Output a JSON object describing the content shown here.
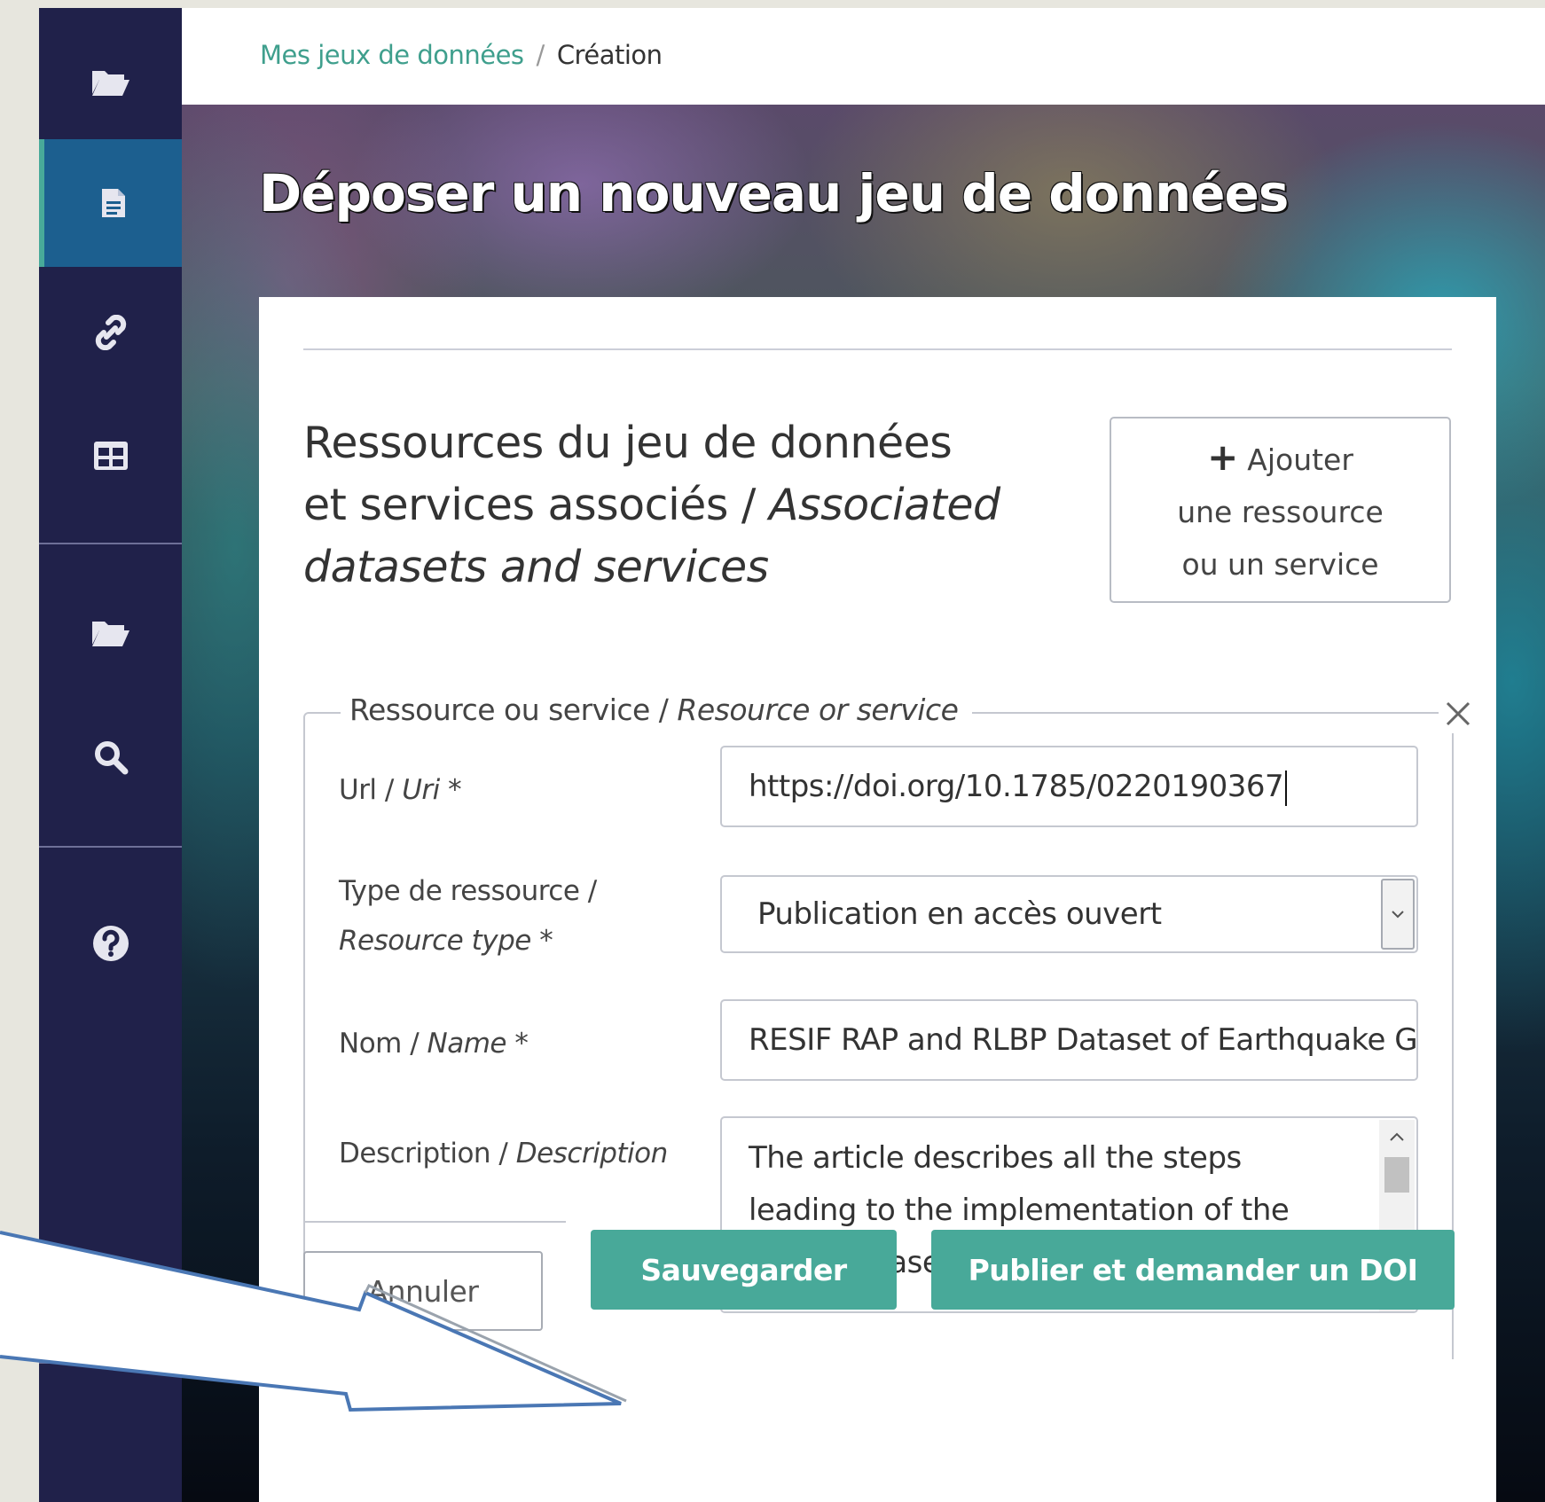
{
  "breadcrumb": {
    "parent": "Mes jeux de données",
    "separator": "/",
    "current": "Création"
  },
  "sidebar": {
    "items": [
      {
        "icon": "folder-open-icon",
        "active": false
      },
      {
        "icon": "document-icon",
        "active": true
      },
      {
        "icon": "link-icon",
        "active": false
      },
      {
        "icon": "table-icon",
        "active": false
      },
      {
        "icon": "folder-open-icon",
        "active": false
      },
      {
        "icon": "search-icon",
        "active": false
      },
      {
        "icon": "help-circle-icon",
        "active": false
      }
    ]
  },
  "hero": {
    "title": "Déposer un nouveau jeu de données"
  },
  "section": {
    "title_fr_1": "Ressources du jeu de données",
    "title_fr_2": "et services associés / ",
    "title_en_1": "Associated",
    "title_en_2": "datasets and services",
    "add_icon": "plus-icon",
    "add_line1": "Ajouter",
    "add_line2": "une ressource",
    "add_line3": "ou un service"
  },
  "resource_form": {
    "legend_fr": "Ressource ou service / ",
    "legend_en": "Resource or service",
    "close_icon": "close-icon",
    "url": {
      "label_fr": "Url / ",
      "label_en": "Uri",
      "required": " *",
      "value": "https://doi.org/10.1785/0220190367"
    },
    "type": {
      "label_fr": "Type de ressource /",
      "label_en": "Resource type",
      "required": " *",
      "value": "Publication en accès ouvert"
    },
    "name": {
      "label_fr": "Nom / ",
      "label_en": "Name",
      "required": " *",
      "value": "RESIF RAP and RLBP Dataset of Earthquake Ground Motion in Mainland France"
    },
    "description": {
      "label_fr": "Description / ",
      "label_en": "Description",
      "value": "The article describes all the steps leading to the implementation of the RESIF dataset."
    }
  },
  "actions": {
    "cancel": "Annuler",
    "save": "Sauvegarder",
    "publish": "Publier et demander un DOI"
  },
  "colors": {
    "sidebar": "#20214a",
    "sidebar_active": "#1c5f8f",
    "accent": "#48a999",
    "arrow": "#4a77b4"
  }
}
